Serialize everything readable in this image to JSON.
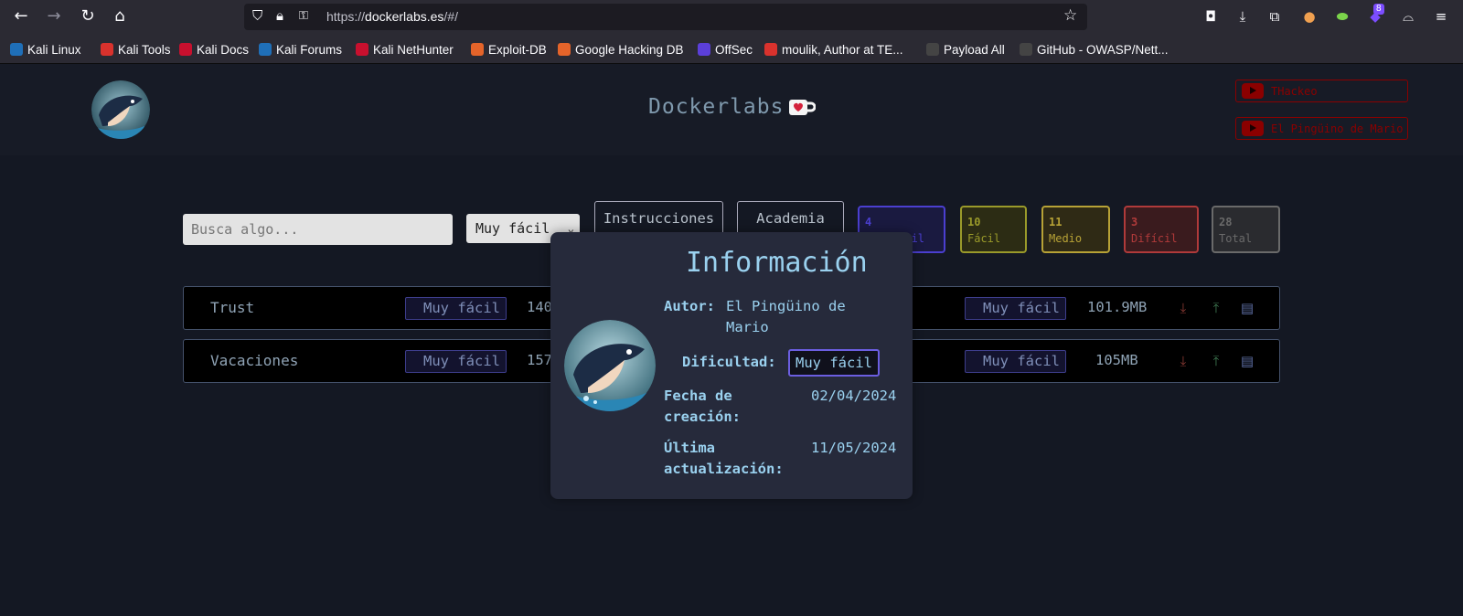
{
  "browser": {
    "url_prefix": "https://",
    "url_host": "dockerlabs.es",
    "url_path": "/#/",
    "extension_badge": "8",
    "bookmarks": [
      {
        "label": "Kali Linux",
        "color": "#1f6fb8"
      },
      {
        "label": "Kali Tools",
        "color": "#d9322d"
      },
      {
        "label": "Kali Docs",
        "color": "#c8102e"
      },
      {
        "label": "Kali Forums",
        "color": "#1f6fb8"
      },
      {
        "label": "Kali NetHunter",
        "color": "#c8102e"
      },
      {
        "label": "Exploit-DB",
        "color": "#e4642a"
      },
      {
        "label": "Google Hacking DB",
        "color": "#e4642a"
      },
      {
        "label": "OffSec",
        "color": "#5b3fd9"
      },
      {
        "label": "moulik, Author at TE...",
        "color": "#d9322d"
      },
      {
        "label": "Payload All",
        "color": "#444"
      },
      {
        "label": "GitHub - OWASP/Nett...",
        "color": "#444"
      }
    ]
  },
  "header": {
    "title": "Dockerlabs",
    "youtube_links": [
      "THackeo",
      "El Pingüino de Mario"
    ]
  },
  "filters": {
    "search_placeholder": "Busca algo...",
    "difficulty_selected": "Muy fácil",
    "instructions_label": "Instrucciones",
    "academy_label": "Academia"
  },
  "stats": [
    {
      "count": "4",
      "label": "Muy fácil",
      "color": "#4b3fd0",
      "bg": "#1a1a40"
    },
    {
      "count": "10",
      "label": "Fácil",
      "color": "#9a9a2a",
      "bg": "#2c2c14"
    },
    {
      "count": "11",
      "label": "Medio",
      "color": "#b7a236",
      "bg": "#2f2a15"
    },
    {
      "count": "3",
      "label": "Difícil",
      "color": "#b03a3a",
      "bg": "#3a1b1e"
    },
    {
      "count": "28",
      "label": "Total",
      "color": "#6a6a6a",
      "bg": "#2a2b2f"
    }
  ],
  "machines": [
    {
      "name": "Trust",
      "badge": "Muy fácil",
      "partial": "140",
      "size": "101.9MB"
    },
    {
      "name": "Vacaciones",
      "badge": "Muy fácil",
      "partial": "157",
      "size": "105MB"
    }
  ],
  "modal": {
    "title": "Información",
    "author_label": "Autor:",
    "author_line1": "El Pingüino de",
    "author_line2": "Mario",
    "difficulty_label": "Dificultad:",
    "difficulty_value": "Muy fácil",
    "created_label_1": "Fecha de",
    "created_label_2": "creación:",
    "created_value": "02/04/2024",
    "updated_label_1": "Última",
    "updated_label_2": "actualización:",
    "updated_value": "11/05/2024"
  }
}
